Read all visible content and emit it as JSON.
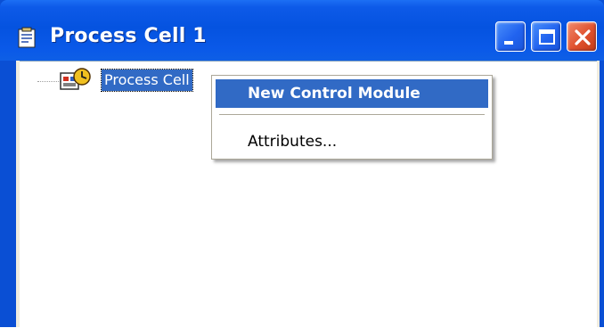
{
  "window": {
    "title": "Process Cell 1",
    "title_icon": "document-clipboard-icon",
    "controls": [
      "minimize-icon",
      "maximize-icon",
      "close-icon"
    ]
  },
  "tree": {
    "node_label": "Process Cell",
    "node_icon": "process-cell-clock-icon",
    "selected": true
  },
  "context_menu": {
    "items": [
      {
        "label": "New Control Module",
        "highlighted": true
      },
      {
        "label": "Attributes..."
      }
    ]
  },
  "colors": {
    "titlebar": "#0553e0",
    "selection": "#316ac5",
    "close_button": "#e0512e"
  }
}
